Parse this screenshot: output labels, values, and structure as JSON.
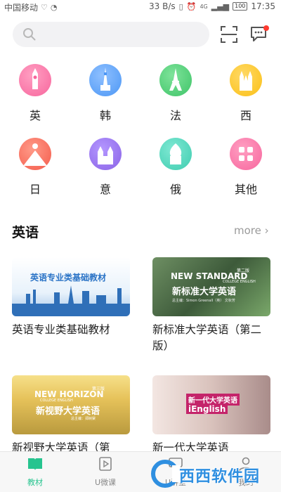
{
  "status_bar": {
    "carrier": "中国移动",
    "speed": "33 B/s",
    "network": "4G",
    "battery": "100",
    "time": "17:35"
  },
  "search": {
    "placeholder": ""
  },
  "languages": [
    {
      "label": "英",
      "icon": "big-ben-icon",
      "color": "#f7669d"
    },
    {
      "label": "韩",
      "icon": "tower-icon",
      "color": "#4c97f5"
    },
    {
      "label": "法",
      "icon": "eiffel-tower-icon",
      "color": "#3fc468"
    },
    {
      "label": "西",
      "icon": "cathedral-icon",
      "color": "#fbc017"
    },
    {
      "label": "日",
      "icon": "mount-fuji-icon",
      "color": "#f45b4b"
    },
    {
      "label": "意",
      "icon": "castle-icon",
      "color": "#8a63e6"
    },
    {
      "label": "俄",
      "icon": "onion-dome-icon",
      "color": "#3fcdb0"
    },
    {
      "label": "其他",
      "icon": "grid-icon",
      "color": "#f7669d"
    }
  ],
  "section": {
    "title": "英语",
    "more": "more"
  },
  "books": [
    {
      "title": "英语专业类基础教材",
      "cover_text": "英语专业类基础教材"
    },
    {
      "title": "新标准大学英语（第二版）",
      "cover_brand": "NEW STANDARD",
      "cover_sub": "COLLEGE ENGLISH",
      "cover_cn": "新标准大学英语",
      "cover_edition": "第二版",
      "cover_editor": "总主编：Simon Greenall（英） 文秋芳"
    },
    {
      "title": "新视野大学英语（第",
      "cover_brand": "NEW HORIZON",
      "cover_sub": "COLLEGE ENGLISH",
      "cover_cn": "新视野大学英语",
      "cover_edition": "第三版",
      "cover_editor": "总主编：郑树棠"
    },
    {
      "title": "新一代大学英语",
      "cover_cn": "新一代大学英语",
      "cover_brand": "iEnglish"
    }
  ],
  "bottom_nav": [
    {
      "label": "教材",
      "icon": "book-icon",
      "active": true
    },
    {
      "label": "U微课",
      "icon": "video-icon",
      "active": false
    },
    {
      "label": "U讲堂",
      "icon": "lecture-icon",
      "active": false
    },
    {
      "label": "我的",
      "icon": "profile-icon",
      "active": false
    }
  ],
  "watermark": {
    "text": "西西软件园"
  },
  "colors": {
    "accent": "#27c48f",
    "badge": "#ff3b30"
  }
}
